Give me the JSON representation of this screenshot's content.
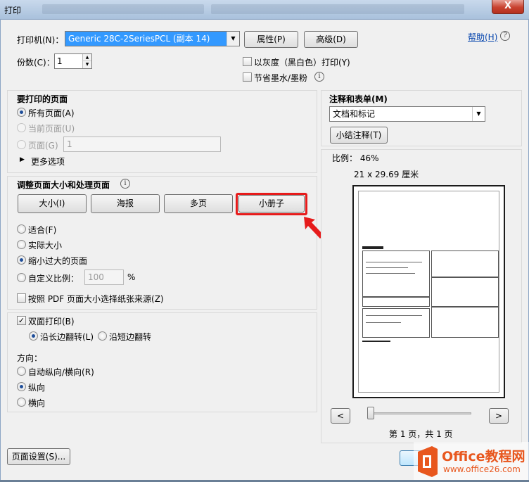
{
  "window": {
    "title": "打印",
    "close_label": "X"
  },
  "printer": {
    "label": "打印机(N)：",
    "selected": "Generic 28C-2SeriesPCL (副本 14)",
    "properties_button": "属性(P)",
    "advanced_button": "高级(D)",
    "help_link": "帮助(H)"
  },
  "copies": {
    "label": "份数(C)：",
    "value": "1"
  },
  "options": {
    "grayscale": "以灰度（黑白色）打印(Y)",
    "save_ink": "节省墨水/墨粉"
  },
  "pages_to_print": {
    "heading": "要打印的页面",
    "all_pages": "所有页面(A)",
    "current_page": "当前页面(U)",
    "pages": "页面(G)",
    "pages_value": "1",
    "more_options": "更多选项"
  },
  "page_sizing": {
    "heading": "调整页面大小和处理页面",
    "tabs": [
      "大小(I)",
      "海报",
      "多页",
      "小册子"
    ],
    "fit": "适合(F)",
    "actual_size": "实际大小",
    "shrink": "缩小过大的页面",
    "custom_scale": "自定义比例：",
    "custom_scale_value": "100",
    "percent": "%",
    "choose_paper": "按照 PDF 页面大小选择纸张来源(Z)"
  },
  "duplex": {
    "label": "双面打印(B)",
    "long_edge": "沿长边翻转(L)",
    "short_edge": "沿短边翻转"
  },
  "orientation": {
    "heading": "方向：",
    "auto": "自动纵向/横向(R)",
    "portrait": "纵向",
    "landscape": "横向"
  },
  "comments": {
    "heading": "注释和表单(M)",
    "selected": "文档和标记",
    "summarize_button": "小结注释(T)"
  },
  "preview": {
    "scale": "比例： 46%",
    "paper_size": "21 x 29.69 厘米",
    "page_count": "第 1 页，共 1 页",
    "prev": "<",
    "next": ">"
  },
  "footer": {
    "page_setup_button": "页面设置(S)..."
  },
  "watermark": {
    "brand": "Office教程网",
    "url": "www.office26.com"
  },
  "colors": {
    "accent": "#3399ff",
    "highlight": "#e61b1b",
    "logo_orange": "#e8571e"
  }
}
